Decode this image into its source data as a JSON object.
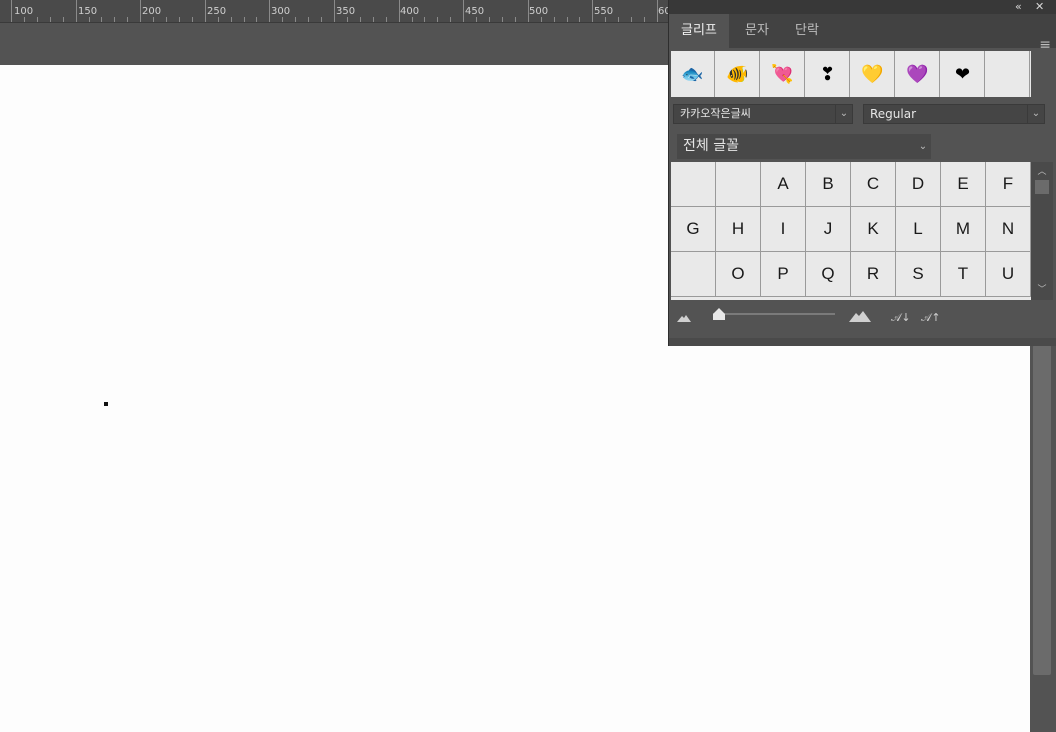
{
  "ruler": {
    "labels": [
      "100",
      "150",
      "200",
      "250",
      "300",
      "350",
      "400",
      "450",
      "500",
      "550",
      "60"
    ]
  },
  "panel": {
    "collapse_icon": "double-chevron-icon",
    "close_icon": "close-icon",
    "tabs": [
      {
        "label": "글리프",
        "active": true
      },
      {
        "label": "문자",
        "active": false
      },
      {
        "label": "단락",
        "active": false
      }
    ],
    "menu_icon": "hamburger-menu-icon",
    "recent_glyphs": [
      {
        "glyph": "🐟",
        "icon": "fish-emoji"
      },
      {
        "glyph": "🐠",
        "icon": "tropical-fish-emoji"
      },
      {
        "glyph": "💘",
        "icon": "heart-arrow-emoji"
      },
      {
        "glyph": "❣",
        "icon": "heart-exclamation-emoji"
      },
      {
        "glyph": "💛",
        "icon": "yellow-heart-emoji"
      },
      {
        "glyph": "💜",
        "icon": "purple-heart-emoji"
      },
      {
        "glyph": "❤",
        "icon": "red-heart-emoji"
      },
      {
        "glyph": "",
        "icon": "empty"
      }
    ],
    "font_family": "카카오작은글씨",
    "font_style": "Regular",
    "glyph_filter": "전체 글꼴",
    "glyph_rows": [
      [
        "",
        "",
        "A",
        "B",
        "C",
        "D",
        "E",
        "F"
      ],
      [
        "G",
        "H",
        "I",
        "J",
        "K",
        "L",
        "M",
        "N"
      ],
      [
        "",
        "O",
        "P",
        "Q",
        "R",
        "S",
        "T",
        "U"
      ]
    ]
  },
  "colors": {
    "workspace": "#535353",
    "canvas": "#fdfdfd",
    "panel_cell_bg": "#e9e9e9",
    "selection_blue": "#3a74d8"
  }
}
